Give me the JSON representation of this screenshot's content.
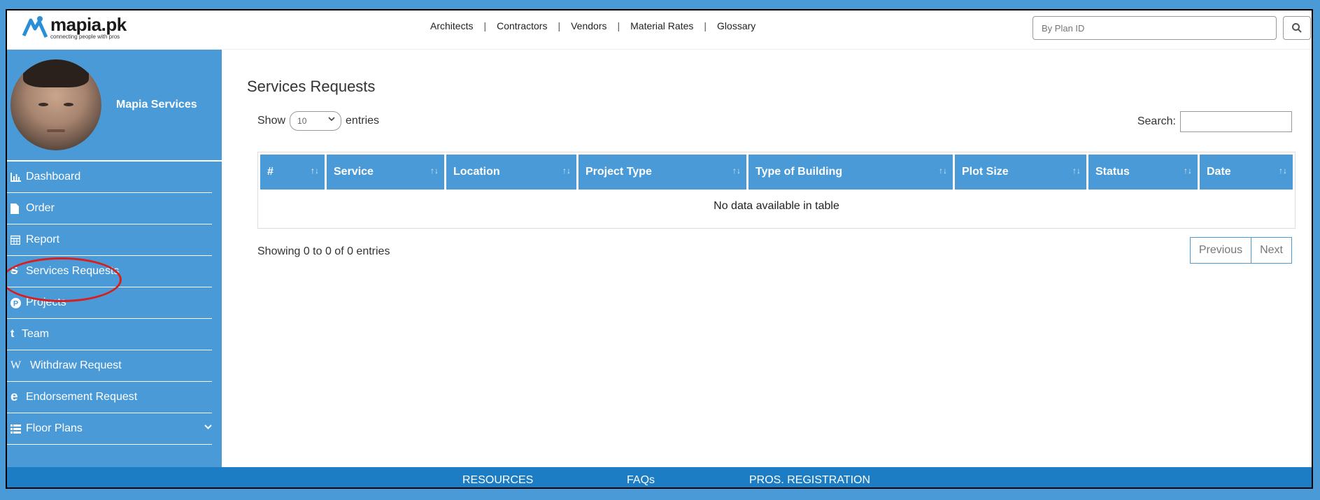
{
  "logo": {
    "name": "mapia.pk",
    "tagline": "connecting people with pros"
  },
  "topnav": {
    "links": [
      "Architects",
      "Contractors",
      "Vendors",
      "Material Rates",
      "Glossary"
    ],
    "separator": "|"
  },
  "plan_search": {
    "placeholder": "By Plan ID"
  },
  "profile": {
    "name": "Mapia Services"
  },
  "sidebar": {
    "items": [
      {
        "label": "Dashboard",
        "icon": "bar-chart-icon"
      },
      {
        "label": "Order",
        "icon": "file-icon"
      },
      {
        "label": "Report",
        "icon": "calendar-icon"
      },
      {
        "label": "Services Requests",
        "icon": "strikethrough-s-icon"
      },
      {
        "label": "Projects",
        "icon": "p-circle-icon"
      },
      {
        "label": "Team",
        "icon": "t-letter-icon"
      },
      {
        "label": "Withdraw Request",
        "icon": "w-letter-icon"
      },
      {
        "label": "Endorsement Request",
        "icon": "e-letter-icon"
      },
      {
        "label": "Floor Plans",
        "icon": "list-icon"
      }
    ]
  },
  "main": {
    "title": "Services Requests",
    "show_label": "Show",
    "entries_label": "entries",
    "page_length": "10",
    "search_label": "Search:",
    "table": {
      "columns": [
        "#",
        "Service",
        "Location",
        "Project Type",
        "Type of Building",
        "Plot Size",
        "Status",
        "Date"
      ],
      "empty_message": "No data available in table"
    },
    "info": "Showing 0 to 0 of 0 entries",
    "pager": {
      "previous": "Previous",
      "next": "Next"
    }
  },
  "footer": {
    "links": [
      "RESOURCES",
      "FAQs",
      "PROS. REGISTRATION"
    ]
  },
  "colors": {
    "primary": "#4a9ad8",
    "footer": "#1c7dc4",
    "highlight": "#d81e1e"
  }
}
